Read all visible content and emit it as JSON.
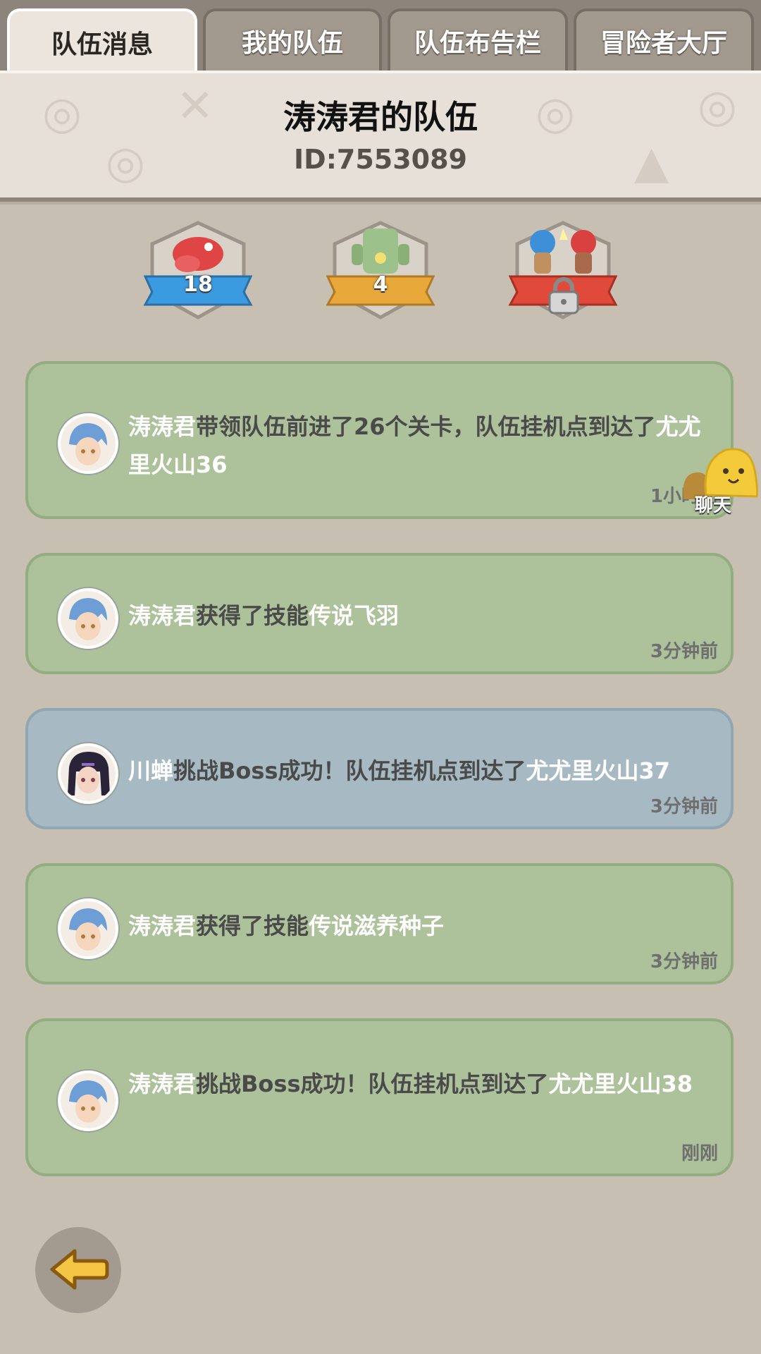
{
  "tabs": [
    {
      "label": "队伍消息",
      "active": true
    },
    {
      "label": "我的队伍",
      "active": false
    },
    {
      "label": "队伍布告栏",
      "active": false
    },
    {
      "label": "冒险者大厅",
      "active": false
    }
  ],
  "header": {
    "title": "涛涛君的队伍",
    "id_text": "ID:7553089"
  },
  "badges": [
    {
      "icon": "red-dinosaur-icon",
      "value": "18",
      "ribbon_color": "#3b9be0"
    },
    {
      "icon": "green-golem-icon",
      "value": "4",
      "ribbon_color": "#e8a83a"
    },
    {
      "icon": "battle-heroes-icon",
      "locked": true,
      "ribbon_color": "#e04a3a"
    }
  ],
  "messages": [
    {
      "parts": [
        {
          "text": "涛涛君",
          "hl": true
        },
        {
          "text": "带领队伍前进了26个关卡，队伍挂机点到达了",
          "hl": false
        },
        {
          "text": "尤尤里火山36",
          "hl": true
        }
      ],
      "time": "1小时前",
      "style": "green",
      "avatar": "blue-hair-avatar"
    },
    {
      "parts": [
        {
          "text": "涛涛君",
          "hl": true
        },
        {
          "text": "获得了技能",
          "hl": false
        },
        {
          "text": "传说飞羽",
          "hl": true
        }
      ],
      "time": "3分钟前",
      "style": "green",
      "avatar": "blue-hair-avatar"
    },
    {
      "parts": [
        {
          "text": "川蝉",
          "hl": true
        },
        {
          "text": "挑战Boss成功！队伍挂机点到达了",
          "hl": false
        },
        {
          "text": "尤尤里火山37",
          "hl": true
        }
      ],
      "time": "3分钟前",
      "style": "blue",
      "avatar": "dark-hair-avatar"
    },
    {
      "parts": [
        {
          "text": "涛涛君",
          "hl": true
        },
        {
          "text": "获得了技能",
          "hl": false
        },
        {
          "text": "传说滋养种子",
          "hl": true
        }
      ],
      "time": "3分钟前",
      "style": "green",
      "avatar": "blue-hair-avatar"
    },
    {
      "parts": [
        {
          "text": "涛涛君",
          "hl": true
        },
        {
          "text": "挑战Boss成功！队伍挂机点到达了",
          "hl": false
        },
        {
          "text": "尤尤里火山38",
          "hl": true
        }
      ],
      "time": "刚刚",
      "style": "green",
      "avatar": "blue-hair-avatar"
    }
  ],
  "chat": {
    "label": "聊天",
    "icon": "chat-blob-icon"
  },
  "back": {
    "icon": "back-arrow-icon"
  }
}
